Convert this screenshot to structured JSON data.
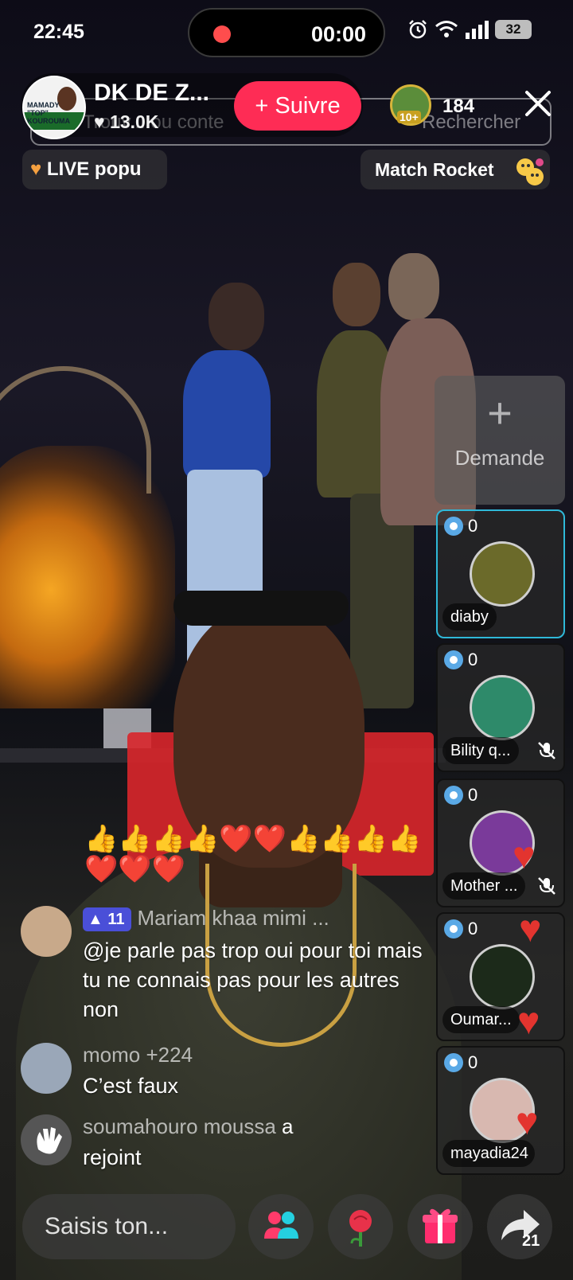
{
  "status_bar": {
    "time": "22:45",
    "recording_time": "00:00",
    "battery": "32"
  },
  "host": {
    "name": "DK DE Z...",
    "likes": "13.0K",
    "avatar_text": "MAMADY \"TOP\" KOUROUMA",
    "follow_label": "+ Suivre"
  },
  "ghost_header": {
    "left_text": "Trouv... ou conte",
    "right_text": "Rechercher"
  },
  "viewers": {
    "badge_level": "10+",
    "count": "184"
  },
  "pills": {
    "live_label": "LIVE popu",
    "match_label": "Match Rocket"
  },
  "request": {
    "plus": "+",
    "label": "Demande"
  },
  "guests": [
    {
      "score": "0",
      "name": "diaby",
      "avatar_color": "#6b6a2a",
      "muted": false,
      "active": true
    },
    {
      "score": "0",
      "name": "Bility q...",
      "avatar_color": "#2e8a6a",
      "muted": true,
      "active": false
    },
    {
      "score": "0",
      "name": "Mother ...",
      "avatar_color": "#7a3a9a",
      "muted": true,
      "active": false
    },
    {
      "score": "0",
      "name": "Oumar...",
      "avatar_color": "#1c2a1a",
      "muted": false,
      "active": false
    },
    {
      "score": "0",
      "name": "mayadia24",
      "avatar_color": "#d8b8b0",
      "muted": false,
      "active": false
    }
  ],
  "chat": [
    {
      "user": "Mariam khaa mimi ...",
      "level": "11",
      "message": "@je parle pas trop oui pour toi mais tu ne connais pas pour les autres non",
      "avatar_color": "#c8a98a"
    },
    {
      "user": "momo +224",
      "message": "C’est faux",
      "avatar_color": "#9aa7b8"
    },
    {
      "user": "soumahouro moussa",
      "action": "a",
      "message": "rejoint",
      "avatar_color": "#555555"
    }
  ],
  "emoji_lines": {
    "line1": "👍👍👍👍❤️❤️👍👍👍👍",
    "line2": "❤️❤️❤️"
  },
  "bottom_bar": {
    "comment_placeholder": "Saisis ton...",
    "share_count": "21"
  },
  "colors": {
    "follow": "#fe2c55",
    "active_guest_border": "#2fb8d8",
    "level_badge": "#4a4fd8"
  }
}
